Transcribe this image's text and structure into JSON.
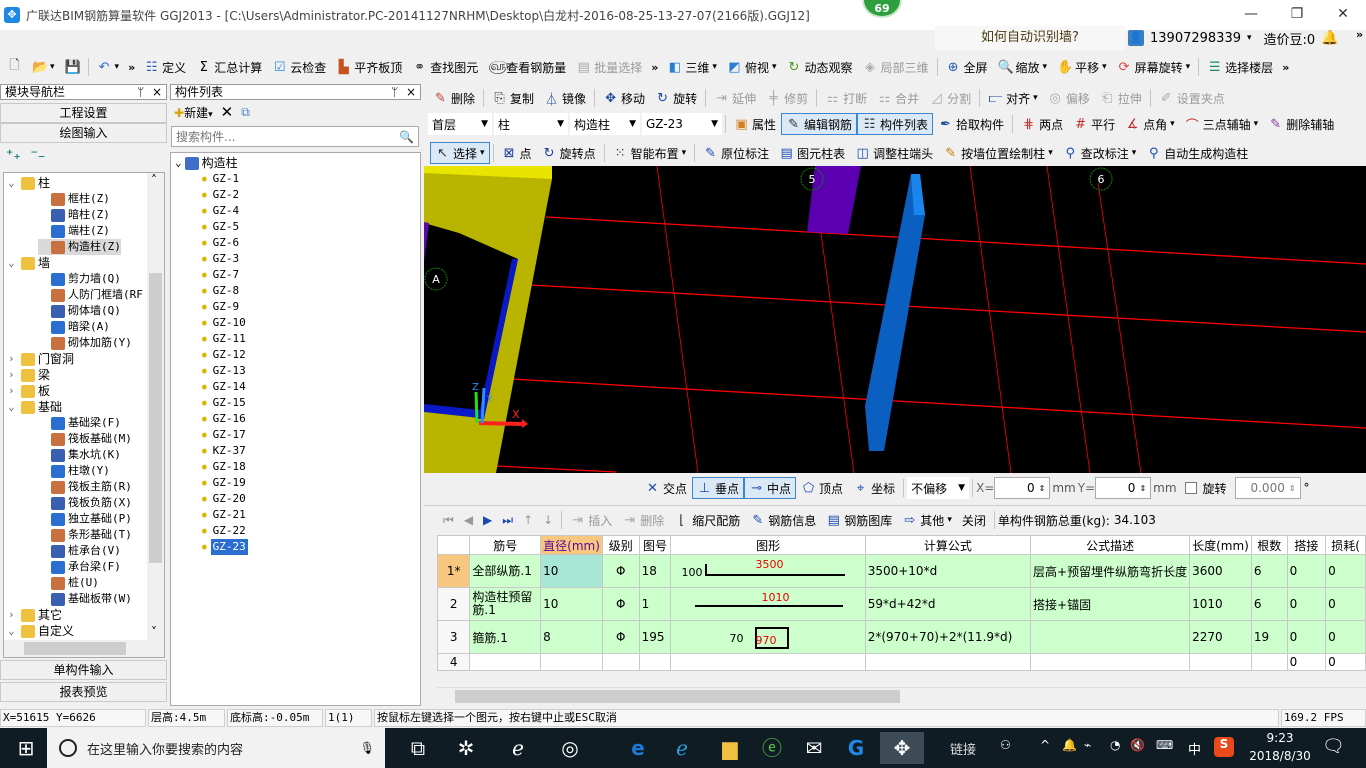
{
  "window": {
    "title": "广联达BIM钢筋算量软件 GGJ2013 - [C:\\Users\\Administrator.PC-20141127NRHM\\Desktop\\白龙村-2016-08-25-13-27-07(2166版).GGJ12]",
    "badge": "69",
    "minimize": "—",
    "restore": "❐",
    "close": "✕"
  },
  "header": {
    "help_text": "如何自动识别墙?",
    "account": "13907298339",
    "coins": "造价豆:0",
    "more": "»"
  },
  "main_toolbar": [
    {
      "icon": "new-file",
      "label": ""
    },
    {
      "icon": "open-folder",
      "label": "",
      "dropdown": true
    },
    {
      "icon": "save",
      "label": ""
    },
    {
      "sep": true
    },
    {
      "icon": "undo",
      "label": "",
      "dropdown": true
    },
    {
      "more": true
    },
    {
      "icon": "define",
      "label": "定义"
    },
    {
      "icon": "sigma",
      "label": "汇总计算"
    },
    {
      "icon": "cloud-check",
      "label": "云检查"
    },
    {
      "icon": "level-top",
      "label": "平齐板顶"
    },
    {
      "icon": "binoculars",
      "label": "查找图元"
    },
    {
      "icon": "glasses",
      "label": "查看钢筋量"
    },
    {
      "icon": "batch-select",
      "label": "批量选择",
      "disabled": true
    },
    {
      "more": true
    },
    {
      "icon": "cube-3d",
      "label": "三维",
      "dropdown": true
    },
    {
      "icon": "top-view",
      "label": "俯视",
      "dropdown": true
    },
    {
      "icon": "orbit",
      "label": "动态观察"
    },
    {
      "icon": "partial-3d",
      "label": "局部三维",
      "disabled": true
    },
    {
      "sep": true
    },
    {
      "icon": "fullscreen",
      "label": "全屏"
    },
    {
      "icon": "zoom",
      "label": "缩放",
      "dropdown": true
    },
    {
      "icon": "pan-hand",
      "label": "平移",
      "dropdown": true
    },
    {
      "icon": "screen-rotate",
      "label": "屏幕旋转",
      "dropdown": true
    },
    {
      "sep": true
    },
    {
      "icon": "floors",
      "label": "选择楼层"
    },
    {
      "more": true
    }
  ],
  "nav_panel": {
    "title": "模块导航栏",
    "pin": "ᛘ",
    "close": "×",
    "buttons": [
      "工程设置",
      "绘图输入"
    ],
    "bottom_buttons": [
      "单构件输入",
      "报表预览"
    ],
    "tree": [
      {
        "label": "柱",
        "level": 0,
        "open": true
      },
      {
        "label": "框柱(Z)",
        "level": 1
      },
      {
        "label": "暗柱(Z)",
        "level": 1
      },
      {
        "label": "端柱(Z)",
        "level": 1
      },
      {
        "label": "构造柱(Z)",
        "level": 1,
        "selected": true
      },
      {
        "label": "墙",
        "level": 0,
        "open": true
      },
      {
        "label": "剪力墙(Q)",
        "level": 1
      },
      {
        "label": "人防门框墙(RF",
        "level": 1
      },
      {
        "label": "砌体墙(Q)",
        "level": 1
      },
      {
        "label": "暗梁(A)",
        "level": 1
      },
      {
        "label": "砌体加筋(Y)",
        "level": 1
      },
      {
        "label": "门窗洞",
        "level": 0
      },
      {
        "label": "梁",
        "level": 0
      },
      {
        "label": "板",
        "level": 0
      },
      {
        "label": "基础",
        "level": 0,
        "open": true
      },
      {
        "label": "基础梁(F)",
        "level": 1
      },
      {
        "label": "筏板基础(M)",
        "level": 1
      },
      {
        "label": "集水坑(K)",
        "level": 1
      },
      {
        "label": "柱墩(Y)",
        "level": 1
      },
      {
        "label": "筏板主筋(R)",
        "level": 1
      },
      {
        "label": "筏板负筋(X)",
        "level": 1
      },
      {
        "label": "独立基础(P)",
        "level": 1
      },
      {
        "label": "条形基础(T)",
        "level": 1
      },
      {
        "label": "桩承台(V)",
        "level": 1
      },
      {
        "label": "承台梁(F)",
        "level": 1
      },
      {
        "label": "桩(U)",
        "level": 1
      },
      {
        "label": "基础板带(W)",
        "level": 1
      },
      {
        "label": "其它",
        "level": 0
      },
      {
        "label": "自定义",
        "level": 0,
        "open": true
      }
    ]
  },
  "component_panel": {
    "title": "构件列表",
    "pin": "ᛘ",
    "close": "×",
    "new_label": "新建",
    "search_placeholder": "搜索构件...",
    "root": "构造柱",
    "items": [
      "GZ-1",
      "GZ-2",
      "GZ-4",
      "GZ-5",
      "GZ-6",
      "GZ-3",
      "GZ-7",
      "GZ-8",
      "GZ-9",
      "GZ-10",
      "GZ-11",
      "GZ-12",
      "GZ-13",
      "GZ-14",
      "GZ-15",
      "GZ-16",
      "GZ-17",
      "KZ-37",
      "GZ-18",
      "GZ-19",
      "GZ-20",
      "GZ-21",
      "GZ-22",
      "GZ-23"
    ],
    "selected": "GZ-23"
  },
  "edit_toolbar": [
    {
      "icon": "eraser",
      "label": "删除"
    },
    {
      "sep": true
    },
    {
      "icon": "copy",
      "label": "复制"
    },
    {
      "icon": "mirror",
      "label": "镜像"
    },
    {
      "sep": true
    },
    {
      "icon": "move",
      "label": "移动"
    },
    {
      "icon": "rotate",
      "label": "旋转"
    },
    {
      "sep": true
    },
    {
      "icon": "extend",
      "label": "延伸",
      "disabled": true
    },
    {
      "icon": "trim",
      "label": "修剪",
      "disabled": true
    },
    {
      "sep": true
    },
    {
      "icon": "break",
      "label": "打断",
      "disabled": true
    },
    {
      "icon": "merge",
      "label": "合并",
      "disabled": true
    },
    {
      "icon": "split",
      "label": "分割",
      "disabled": true
    },
    {
      "sep": true
    },
    {
      "icon": "align",
      "label": "对齐",
      "dropdown": true
    },
    {
      "icon": "offset",
      "label": "偏移",
      "disabled": true
    },
    {
      "icon": "stretch",
      "label": "拉伸",
      "disabled": true
    },
    {
      "sep": true
    },
    {
      "icon": "grip",
      "label": "设置夹点",
      "disabled": true
    }
  ],
  "selectors": {
    "floor": "首层",
    "type": "柱",
    "subtype": "构造柱",
    "component": "GZ-23"
  },
  "prop_toolbar": [
    {
      "icon": "properties",
      "label": "属性"
    },
    {
      "icon": "edit-rebar",
      "label": "编辑钢筋",
      "active": true
    },
    {
      "icon": "list",
      "label": "构件列表",
      "active": true
    },
    {
      "icon": "eyedropper",
      "label": "拾取构件"
    },
    {
      "sep": true
    },
    {
      "icon": "two-point",
      "label": "两点"
    },
    {
      "icon": "parallel",
      "label": "平行"
    },
    {
      "icon": "point-angle",
      "label": "点角",
      "dropdown": true
    },
    {
      "icon": "three-point-axis",
      "label": "三点辅轴",
      "dropdown": true
    },
    {
      "icon": "delete-axis",
      "label": "删除辅轴"
    }
  ],
  "draw_toolbar": [
    {
      "icon": "cursor",
      "label": "选择",
      "dropdown": true,
      "active": true
    },
    {
      "sep": true
    },
    {
      "icon": "point",
      "label": "点"
    },
    {
      "icon": "rotate-point",
      "label": "旋转点"
    },
    {
      "sep": true
    },
    {
      "icon": "smart-layout",
      "label": "智能布置",
      "dropdown": true
    },
    {
      "sep": true
    },
    {
      "icon": "in-place-label",
      "label": "原位标注"
    },
    {
      "icon": "column-table",
      "label": "图元柱表"
    },
    {
      "icon": "adjust-end",
      "label": "调整柱端头"
    },
    {
      "icon": "draw-by-wall",
      "label": "按墙位置绘制柱",
      "dropdown": true
    },
    {
      "icon": "edit-label",
      "label": "查改标注",
      "dropdown": true
    },
    {
      "icon": "auto-generate",
      "label": "自动生成构造柱"
    }
  ],
  "viewport": {
    "background": "#000000",
    "grid_color": "#ff0000",
    "axis_labels": [
      "A",
      "5",
      "6"
    ],
    "axis_x": "X",
    "axis_y": "Y",
    "axis_z": "Z"
  },
  "snap_toolbar": {
    "items": [
      {
        "icon": "intersection",
        "label": "交点"
      },
      {
        "icon": "perpendicular",
        "label": "垂点",
        "active": true
      },
      {
        "icon": "midpoint",
        "label": "中点",
        "active": true
      },
      {
        "icon": "vertex",
        "label": "顶点"
      },
      {
        "icon": "coordinate",
        "label": "坐标"
      }
    ],
    "offset_mode": "不偏移",
    "x_label": "X=",
    "x_value": "0",
    "y_label": "Y=",
    "y_value": "0",
    "unit": "mm",
    "rotate_label": "旋转",
    "rotate_checked": false,
    "rotate_value": "0.000",
    "degree": "°"
  },
  "rebar_toolbar": {
    "nav": [
      "⏮",
      "◀",
      "▶",
      "⏭",
      "↑",
      "↓"
    ],
    "items": [
      {
        "icon": "insert",
        "label": "插入",
        "disabled": true
      },
      {
        "icon": "delete",
        "label": "删除",
        "disabled": true
      },
      {
        "icon": "scale-rebar",
        "label": "缩尺配筋"
      },
      {
        "icon": "rebar-info",
        "label": "钢筋信息"
      },
      {
        "icon": "rebar-library",
        "label": "钢筋图库"
      },
      {
        "icon": "other",
        "label": "其他",
        "dropdown": true
      },
      {
        "icon": "",
        "label": "关闭"
      }
    ],
    "total_label": "单构件钢筋总重(kg):",
    "total_value": "34.103"
  },
  "rebar_table": {
    "columns": [
      "",
      "筋号",
      "直径(mm)",
      "级别",
      "图号",
      "图形",
      "计算公式",
      "公式描述",
      "长度(mm)",
      "根数",
      "搭接",
      "损耗("
    ],
    "rows": [
      {
        "no": "1*",
        "name": "全部纵筋.1",
        "diameter": "10",
        "grade": "Φ",
        "shape_no": "18",
        "shape_left": "100",
        "shape_value": "3500",
        "formula": "3500+10*d",
        "description": "层高+预留埋件纵筋弯折长度",
        "length": "3600",
        "count": "6",
        "lap": "0",
        "loss": "0"
      },
      {
        "no": "2",
        "name": "构造柱预留筋.1",
        "diameter": "10",
        "grade": "Φ",
        "shape_no": "1",
        "shape_left": "",
        "shape_value": "1010",
        "formula": "59*d+42*d",
        "description": "搭接+锚固",
        "length": "1010",
        "count": "6",
        "lap": "0",
        "loss": "0"
      },
      {
        "no": "3",
        "name": "箍筋.1",
        "diameter": "8",
        "grade": "Φ",
        "shape_no": "195",
        "shape_left": "70",
        "shape_value": "970",
        "formula": "2*(970+70)+2*(11.9*d)",
        "description": "",
        "length": "2270",
        "count": "19",
        "lap": "0",
        "loss": "0"
      },
      {
        "no": "4",
        "name": "",
        "diameter": "",
        "grade": "",
        "shape_no": "",
        "shape_left": "",
        "shape_value": "",
        "formula": "",
        "description": "",
        "length": "",
        "count": "",
        "lap": "0",
        "loss": "0"
      }
    ]
  },
  "status_bar": {
    "coords": "X=51615 Y=6626",
    "floor_height": "层高:4.5m",
    "base_height": "底标高:-0.05m",
    "count": "1(1)",
    "hint": "按鼠标左键选择一个图元，按右键中止或ESC取消",
    "fps": "169.2 FPS"
  },
  "taskbar": {
    "search_placeholder": "在这里输入你要搜索的内容",
    "links": "链接",
    "ime": "中",
    "time": "9:23",
    "date": "2018/8/30"
  }
}
